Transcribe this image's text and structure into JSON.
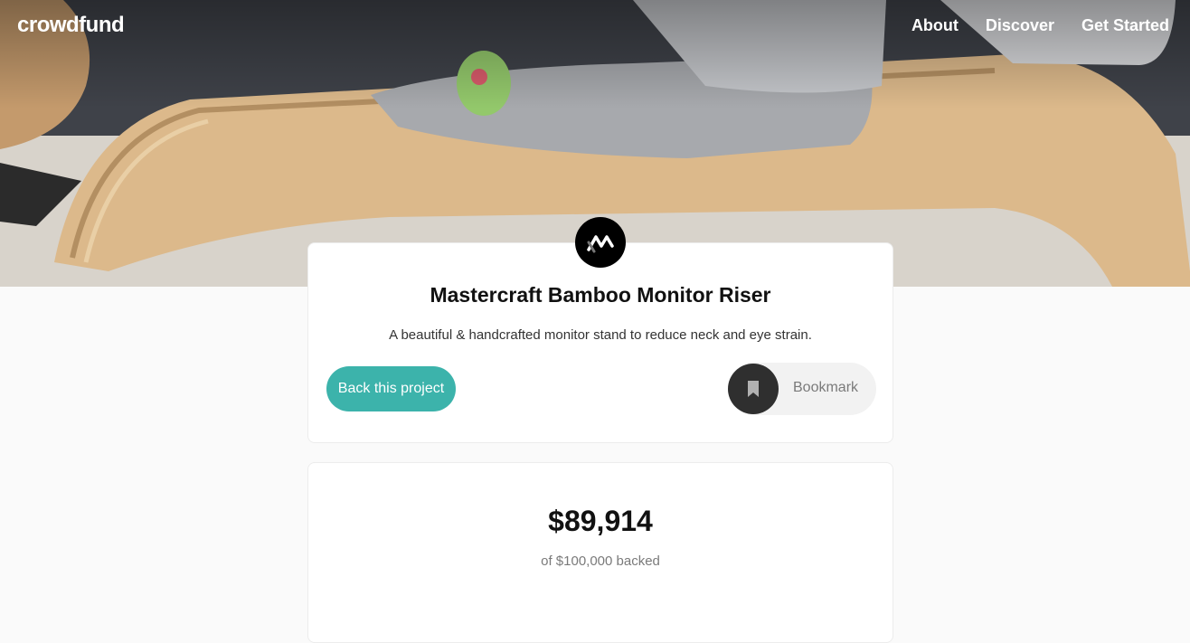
{
  "header": {
    "logo": "crowdfund",
    "nav": [
      "About",
      "Discover",
      "Get Started"
    ]
  },
  "project": {
    "title": "Mastercraft Bamboo Monitor Riser",
    "description": "A beautiful & handcrafted monitor stand to reduce neck and eye strain.",
    "back_label": "Back this project",
    "bookmark_label": "Bookmark"
  },
  "stats": {
    "amount": "$89,914",
    "amount_sub": "of $100,000 backed"
  },
  "colors": {
    "accent": "#3cb3ab",
    "dark": "#2f2f2f",
    "text": "#111111",
    "muted": "#7a7a7a"
  },
  "icons": {
    "brand": "mastercraft-logo-icon",
    "bookmark": "bookmark-icon"
  }
}
